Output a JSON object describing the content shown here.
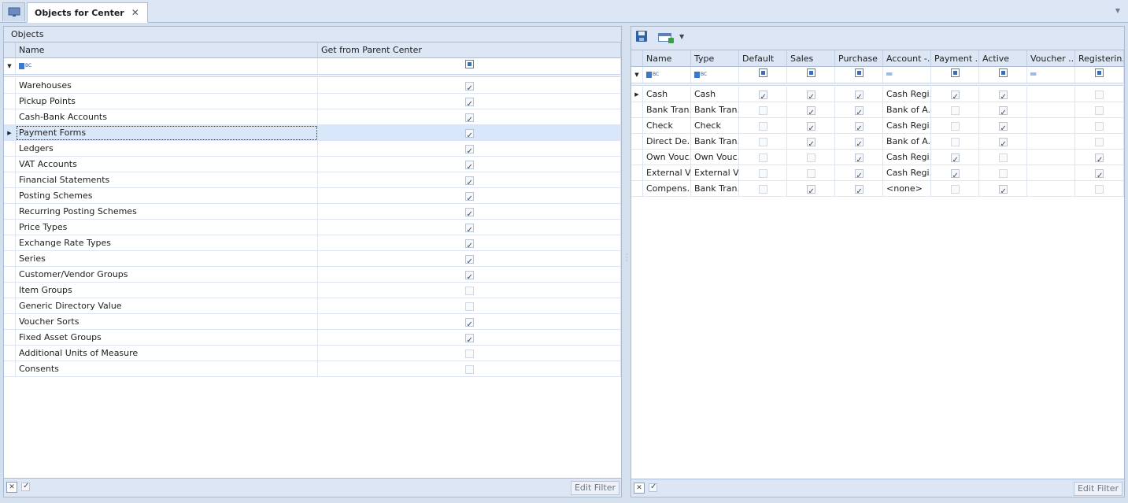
{
  "tab": {
    "title": "Objects for Center",
    "close": "✕"
  },
  "left": {
    "group_label": "Objects",
    "columns": {
      "name": "Name",
      "get_from_parent": "Get from Parent Center"
    },
    "rows": [
      {
        "name": "Warehouses",
        "checked": true
      },
      {
        "name": "Pickup Points",
        "checked": true
      },
      {
        "name": "Cash-Bank Accounts",
        "checked": true
      },
      {
        "name": "Payment Forms",
        "checked": true,
        "selected": true
      },
      {
        "name": "Ledgers",
        "checked": true
      },
      {
        "name": "VAT Accounts",
        "checked": true
      },
      {
        "name": "Financial Statements",
        "checked": true
      },
      {
        "name": "Posting Schemes",
        "checked": true
      },
      {
        "name": "Recurring Posting Schemes",
        "checked": true
      },
      {
        "name": "Price Types",
        "checked": true
      },
      {
        "name": "Exchange Rate Types",
        "checked": true
      },
      {
        "name": "Series",
        "checked": true
      },
      {
        "name": "Customer/Vendor Groups",
        "checked": true
      },
      {
        "name": "Item Groups",
        "checked": false
      },
      {
        "name": "Generic Directory Value",
        "checked": false
      },
      {
        "name": "Voucher Sorts",
        "checked": true
      },
      {
        "name": "Fixed Asset Groups",
        "checked": true
      },
      {
        "name": "Additional Units of Measure",
        "checked": false
      },
      {
        "name": "Consents",
        "checked": false
      }
    ],
    "edit_filter": "Edit Filter"
  },
  "right": {
    "columns": [
      "Name",
      "Type",
      "Default",
      "Sales",
      "Purchase",
      "Account -...",
      "Payment ...",
      "Active",
      "Voucher ...",
      "Registerin..."
    ],
    "rows": [
      {
        "name": "Cash",
        "type": "Cash",
        "default": true,
        "sales": true,
        "purchase": true,
        "account": "Cash Regi...",
        "payment": true,
        "active": true,
        "voucher": "",
        "registering": false,
        "current": true
      },
      {
        "name": "Bank Tran...",
        "type": "Bank Tran...",
        "default": false,
        "sales": true,
        "purchase": true,
        "account": "Bank of A...",
        "payment": false,
        "active": true,
        "voucher": "",
        "registering": false
      },
      {
        "name": "Check",
        "type": "Check",
        "default": false,
        "sales": true,
        "purchase": true,
        "account": "Cash Regi...",
        "payment": false,
        "active": true,
        "voucher": "",
        "registering": false
      },
      {
        "name": "Direct De...",
        "type": "Bank Tran...",
        "default": false,
        "sales": true,
        "purchase": true,
        "account": "Bank of A...",
        "payment": false,
        "active": true,
        "voucher": "",
        "registering": false
      },
      {
        "name": "Own Vouc...",
        "type": "Own Vouc...",
        "default": false,
        "sales": false,
        "purchase": true,
        "account": "Cash Regi...",
        "payment": true,
        "active": false,
        "voucher": "",
        "registering": true
      },
      {
        "name": "External V...",
        "type": "External V...",
        "default": false,
        "sales": false,
        "purchase": true,
        "account": "Cash Regi...",
        "payment": true,
        "active": false,
        "voucher": "",
        "registering": true
      },
      {
        "name": "Compens...",
        "type": "Bank Tran...",
        "default": false,
        "sales": true,
        "purchase": true,
        "account": "<none>",
        "payment": false,
        "active": true,
        "voucher": "",
        "registering": false
      }
    ],
    "edit_filter": "Edit Filter"
  },
  "footer": {
    "clear_filter": "✕"
  }
}
